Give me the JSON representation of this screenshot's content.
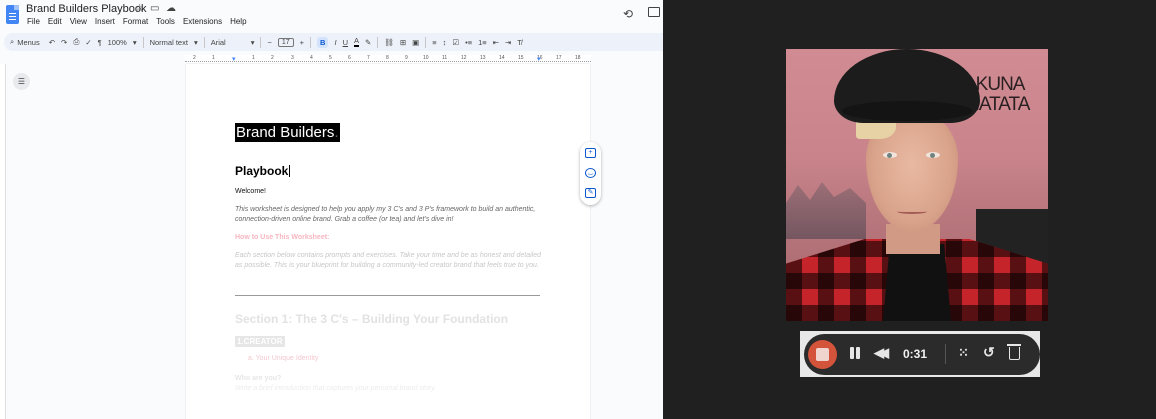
{
  "docs": {
    "title": "Brand Builders Playbook",
    "menu": [
      "File",
      "Edit",
      "View",
      "Insert",
      "Format",
      "Tools",
      "Extensions",
      "Help"
    ],
    "toolbar": {
      "search_label": "Menus",
      "zoom": "100%",
      "style": "Normal text",
      "font": "Arial",
      "font_size": "17",
      "bold": "B",
      "italic": "I",
      "underline": "U",
      "text_color": "A"
    },
    "ruler_numbers": [
      "2",
      "1",
      "1",
      "2",
      "3",
      "4",
      "5",
      "6",
      "7",
      "8",
      "9",
      "10",
      "11",
      "12",
      "13",
      "14",
      "15",
      "16",
      "17",
      "18"
    ],
    "document": {
      "title": "Brand Builders",
      "title_suffix": ".",
      "subtitle": "Playbook",
      "welcome": "Welcome!",
      "intro": "This worksheet is designed to help you apply my 3 C's and 3 P's framework to build an authentic, connection-driven online brand. Grab a coffee (or tea) and let's dive in!",
      "howto_heading": "How to Use This Worksheet:",
      "howto": "Each section below contains prompts and exercises. Take your time and be as honest and detailed as possible. This is your blueprint for building a community-led creator brand that feels true to you.",
      "section1": "Section 1: The 3 C's – Building Your Foundation",
      "creator_tag": "1.CREATOR",
      "bullet": "a.  Your Unique Identity",
      "who_heading": "Who are you?",
      "who_text": "Write a brief introduction that captures your personal brand story."
    }
  },
  "recorder": {
    "background_sign": "AKUNA\nMATATA",
    "timer": "0:31",
    "colors": {
      "stop": "#d4533b",
      "bar": "#2b2b2b"
    }
  }
}
